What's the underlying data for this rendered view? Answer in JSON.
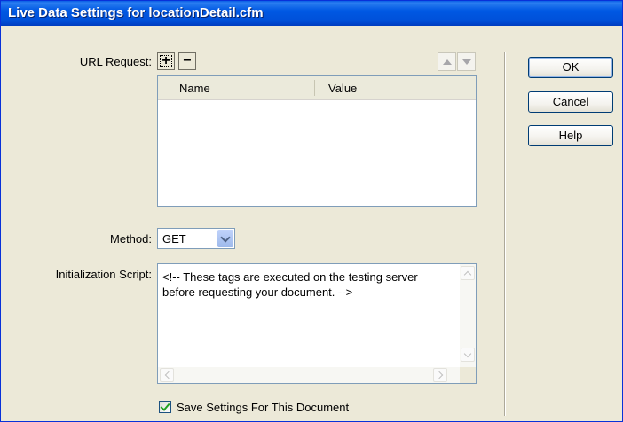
{
  "window": {
    "title": "Live Data Settings for locationDetail.cfm"
  },
  "url_request": {
    "label": "URL Request:",
    "add_symbol": "+",
    "remove_symbol": "−",
    "columns": [
      "Name",
      "Value"
    ],
    "rows": []
  },
  "method": {
    "label": "Method:",
    "value": "GET",
    "options": [
      "GET"
    ]
  },
  "init_script": {
    "label": "Initialization Script:",
    "content": "<!-- These tags are executed on the testing server\nbefore requesting your document. -->"
  },
  "save_settings": {
    "label": "Save Settings For This Document",
    "checked": true
  },
  "buttons": {
    "ok": "OK",
    "cancel": "Cancel",
    "help": "Help"
  },
  "icons": {
    "add": "plus-icon",
    "remove": "minus-icon",
    "move_up": "arrow-up-icon",
    "move_down": "arrow-down-icon",
    "dropdown": "chevron-down-icon",
    "check": "checkmark-icon"
  },
  "colors": {
    "titlebar": "#0058e3",
    "dialog_bg": "#ece9d8",
    "field_border": "#7f9db9",
    "check": "#21a121"
  }
}
